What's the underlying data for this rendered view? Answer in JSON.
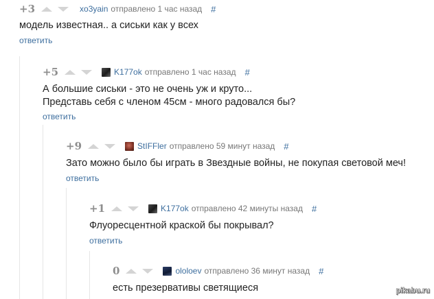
{
  "comments": [
    {
      "rating": "+3",
      "username": "xo3yain",
      "sent": "отправлено 1 час назад",
      "hash": "#",
      "text": [
        "модель известная.. а сиськи как у всех"
      ],
      "reply": "ответить",
      "has_avatar": false
    },
    {
      "rating": "+5",
      "username": "K177ok",
      "sent": "отправлено 1 час назад",
      "hash": "#",
      "text": [
        "А большие сиськи - это не очень уж и круто...",
        "Представь себя с членом 45см - много радовался бы?"
      ],
      "reply": "ответить",
      "has_avatar": true
    },
    {
      "rating": "+9",
      "username": "StIFFler",
      "sent": "отправлено 59 минут назад",
      "hash": "#",
      "text": [
        "Зато можно было бы играть в Звездные войны, не покупая световой меч!"
      ],
      "reply": "ответить",
      "has_avatar": true
    },
    {
      "rating": "+1",
      "username": "K177ok",
      "sent": "отправлено 42 минуты назад",
      "hash": "#",
      "text": [
        "Флуоресцентной краской бы покрывал?"
      ],
      "reply": "ответить",
      "has_avatar": true
    },
    {
      "rating": "0",
      "username": "ololoev",
      "sent": "отправлено 36 минут назад",
      "hash": "#",
      "text": [
        "есть презервативы светящиеся"
      ],
      "reply": "",
      "has_avatar": true
    }
  ],
  "watermark": "pikabu.ru",
  "colors": {
    "link": "#3d6e9e",
    "meta": "#777777",
    "rating": "#8e8e8e",
    "arrow": "#d4d4d4",
    "thread": "#e6e6e6"
  },
  "icons": {
    "upvote": "triangle-up-icon",
    "downvote": "triangle-down-icon"
  }
}
